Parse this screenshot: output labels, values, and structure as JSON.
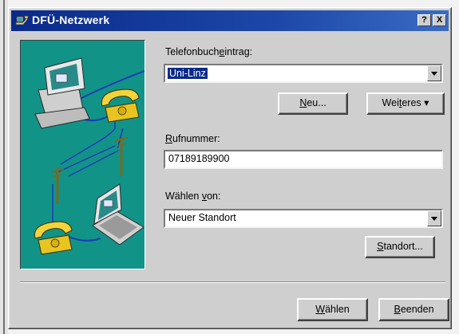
{
  "window": {
    "title": "DFÜ-Netzwerk",
    "help_button": "?",
    "close_button": "X"
  },
  "phonebook": {
    "label_before": "Telefonbuch",
    "label_mnemonic": "e",
    "label_after": "intrag:",
    "selected": "Uni-Linz"
  },
  "buttons": {
    "new_mnemonic": "N",
    "new_rest": "eu...",
    "more_before": "Wei",
    "more_mnemonic": "t",
    "more_after": "eres",
    "more_arrow": "▾",
    "location_mnemonic": "S",
    "location_rest": "tandort...",
    "dial_mnemonic": "W",
    "dial_rest": "ählen",
    "close_mnemonic": "B",
    "close_rest": "eenden"
  },
  "phone_number": {
    "label_mnemonic": "R",
    "label_rest": "ufnummer:",
    "value": "07189189900"
  },
  "dial_from": {
    "label_before": "Wählen ",
    "label_mnemonic": "v",
    "label_after": "on:",
    "selected": "Neuer Standort"
  },
  "colors": {
    "title_bar": "#0a2a8a",
    "illustration_bg": "#129388",
    "dialog_bg": "#cfcfcf",
    "selection": "#0a2a8a"
  }
}
